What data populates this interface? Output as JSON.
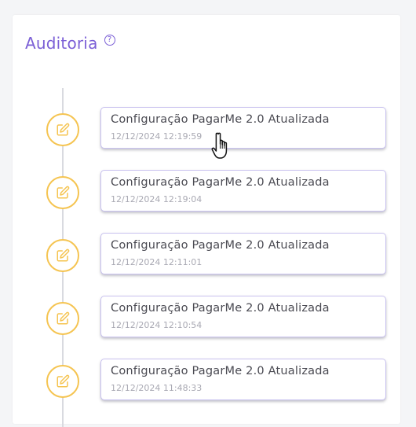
{
  "panel": {
    "title": "Auditoria",
    "help_icon": "question-circle-icon",
    "help_symbol": "?"
  },
  "colors": {
    "title": "#7b5fd6",
    "icon_ring": "#f5c451",
    "card_border": "#c9c2ef",
    "timeline": "#d9dae0"
  },
  "audit_log": [
    {
      "title": "Configuração PagarMe 2.0 Atualizada",
      "timestamp": "12/12/2024 12:19:59",
      "icon": "edit-icon"
    },
    {
      "title": "Configuração PagarMe 2.0 Atualizada",
      "timestamp": "12/12/2024 12:19:04",
      "icon": "edit-icon"
    },
    {
      "title": "Configuração PagarMe 2.0 Atualizada",
      "timestamp": "12/12/2024 12:11:01",
      "icon": "edit-icon"
    },
    {
      "title": "Configuração PagarMe 2.0 Atualizada",
      "timestamp": "12/12/2024 12:10:54",
      "icon": "edit-icon"
    },
    {
      "title": "Configuração PagarMe 2.0 Atualizada",
      "timestamp": "12/12/2024 11:48:33",
      "icon": "edit-icon"
    }
  ],
  "cursor": "hand-pointer-icon"
}
